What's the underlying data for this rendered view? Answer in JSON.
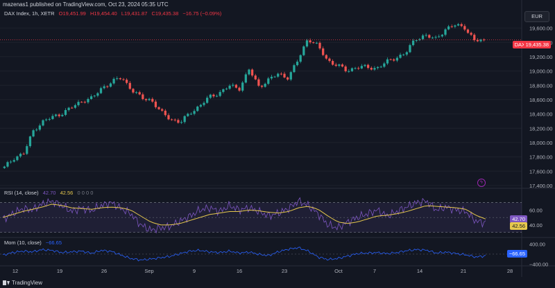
{
  "publisher": "mazenas1 published on TradingView.com, Oct 23, 2024 05:35 UTC",
  "legend": {
    "symbol": "DAX Index, 1h, XETR",
    "open": "O19,451.99",
    "high": "H19,454.40",
    "low": "L19,431.87",
    "close": "C19,435.38",
    "change": "−16.75 (−0.09%)",
    "rsi_label": "RSI (14, close)",
    "rsi_value": "42.70",
    "rsi_ma": "42.56",
    "rsi_extra": "0 0 0 0",
    "mom_label": "Mom (10, close)",
    "mom_value": "−66.65"
  },
  "currency_button": "EUR",
  "current_price_label": "DAX",
  "current_price": "19,435.38",
  "rsi_tag_value": "42.70",
  "rsi_tag_ma": "42.56",
  "mom_tag": "−66.65",
  "footer_brand": "TradingView",
  "colors": {
    "up": "#26a69a",
    "down": "#ef5350",
    "rsi": "#7e57c2",
    "rsi_ma": "#e6c84d",
    "mom": "#2962ff",
    "price_line": "#f23645",
    "rsi_band": "#7e57c2"
  },
  "chart_data": [
    {
      "type": "candlestick",
      "title": "DAX Index, 1h, XETR",
      "y_ticks": [
        19600,
        19400,
        19200,
        19000,
        18800,
        18600,
        18400,
        18200,
        18000,
        17800,
        17600,
        17400
      ],
      "y_tick_labels": [
        "19,600.00",
        "19,400.00",
        "19,200.00",
        "19,000.00",
        "18,800.00",
        "18,600.00",
        "18,400.00",
        "18,200.00",
        "18,000.00",
        "17,800.00",
        "17,600.00",
        "17,400.00"
      ],
      "ylim": [
        17380,
        19780
      ],
      "x_tick_labels": [
        "12",
        "19",
        "26",
        "Sep",
        "9",
        "16",
        "23",
        "Oct",
        "7",
        "14",
        "21",
        "28"
      ],
      "last_close": 19435.38,
      "close_path": [
        [
          "Aug 8",
          17650
        ],
        [
          "Aug 12",
          17790
        ],
        [
          "Aug 14",
          17850
        ],
        [
          "Aug 15",
          18180
        ],
        [
          "Aug 16",
          18300
        ],
        [
          "Aug 19",
          18360
        ],
        [
          "Aug 20",
          18420
        ],
        [
          "Aug 22",
          18500
        ],
        [
          "Aug 26",
          18590
        ],
        [
          "Aug 27",
          18620
        ],
        [
          "Aug 29",
          18770
        ],
        [
          "Aug 30",
          18850
        ],
        [
          "Sep 2",
          18910
        ],
        [
          "Sep 3",
          18740
        ],
        [
          "Sep 4",
          18620
        ],
        [
          "Sep 5",
          18600
        ],
        [
          "Sep 6",
          18420
        ],
        [
          "Sep 9",
          18330
        ],
        [
          "Sep 10",
          18280
        ],
        [
          "Sep 11",
          18420
        ],
        [
          "Sep 12",
          18520
        ],
        [
          "Sep 13",
          18640
        ],
        [
          "Sep 16",
          18700
        ],
        [
          "Sep 17",
          18790
        ],
        [
          "Sep 18",
          18760
        ],
        [
          "Sep 19",
          19020
        ],
        [
          "Sep 20",
          18780
        ],
        [
          "Sep 23",
          18880
        ],
        [
          "Sep 24",
          18960
        ],
        [
          "Sep 25",
          18910
        ],
        [
          "Sep 26",
          19150
        ],
        [
          "Sep 27",
          19460
        ],
        [
          "Sep 30",
          19350
        ],
        [
          "Oct 1",
          19150
        ],
        [
          "Oct 2",
          19080
        ],
        [
          "Oct 3",
          19000
        ],
        [
          "Oct 4",
          19060
        ],
        [
          "Oct 7",
          19050
        ],
        [
          "Oct 8",
          19040
        ],
        [
          "Oct 9",
          19120
        ],
        [
          "Oct 10",
          19190
        ],
        [
          "Oct 11",
          19250
        ],
        [
          "Oct 14",
          19450
        ],
        [
          "Oct 15",
          19500
        ],
        [
          "Oct 16",
          19440
        ],
        [
          "Oct 17",
          19580
        ],
        [
          "Oct 18",
          19640
        ],
        [
          "Oct 21",
          19620
        ],
        [
          "Oct 22",
          19420
        ],
        [
          "Oct 23",
          19435
        ]
      ]
    },
    {
      "type": "line",
      "title": "RSI (14, close)",
      "y_tick_labels": [
        "60.00",
        "40.00"
      ],
      "bands": [
        30,
        70
      ],
      "ylim": [
        26,
        78
      ],
      "series": [
        {
          "name": "RSI",
          "values": [
            48,
            55,
            62,
            60,
            68,
            72,
            66,
            58,
            63,
            59,
            66,
            70,
            62,
            55,
            40,
            33,
            36,
            38,
            45,
            52,
            60,
            63,
            58,
            66,
            60,
            63,
            58,
            52,
            56,
            62,
            72,
            66,
            55,
            40,
            36,
            44,
            50,
            55,
            60,
            52,
            58,
            64,
            70,
            72,
            60,
            64,
            60,
            58,
            45,
            43
          ]
        },
        {
          "name": "RSI MA",
          "values": [
            50,
            54,
            58,
            61,
            64,
            68,
            66,
            63,
            62,
            61,
            63,
            64,
            63,
            60,
            52,
            44,
            40,
            40,
            42,
            46,
            50,
            54,
            56,
            58,
            58,
            60,
            59,
            57,
            56,
            58,
            63,
            65,
            61,
            52,
            44,
            42,
            44,
            48,
            52,
            53,
            55,
            58,
            62,
            66,
            65,
            64,
            63,
            61,
            53,
            48
          ]
        }
      ]
    },
    {
      "type": "line",
      "title": "Mom (10, close)",
      "y_tick_labels": [
        "400.00",
        "−400.00"
      ],
      "ylim": [
        -420,
        420
      ],
      "series": [
        {
          "name": "Mom",
          "values": [
            -40,
            60,
            120,
            90,
            180,
            150,
            60,
            90,
            120,
            30,
            150,
            110,
            -40,
            -180,
            -240,
            -200,
            -150,
            -90,
            20,
            120,
            150,
            90,
            60,
            120,
            40,
            80,
            -10,
            -60,
            100,
            200,
            260,
            120,
            -120,
            -220,
            -180,
            -80,
            20,
            40,
            60,
            20,
            60,
            140,
            180,
            160,
            40,
            80,
            20,
            -30,
            -120,
            -67
          ]
        }
      ]
    }
  ]
}
